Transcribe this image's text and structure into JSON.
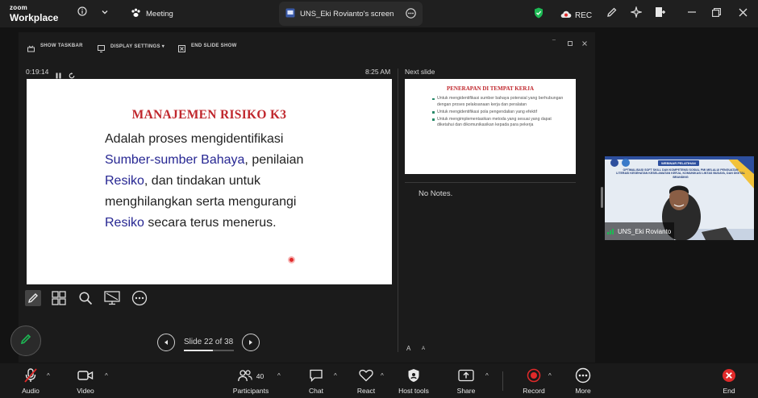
{
  "app": {
    "logo_line1": "zoom",
    "logo_line2": "Workplace"
  },
  "tabs": {
    "meeting": "Meeting",
    "screen": "UNS_Eki Rovianto's screen"
  },
  "status": {
    "rec": "REC"
  },
  "presenter_toolbar": {
    "show_taskbar": "SHOW TASKBAR",
    "display_settings": "DISPLAY SETTINGS ▾",
    "end_slide_show": "END SLIDE SHOW"
  },
  "presenter": {
    "timer": "0:19:14",
    "clock": "8:25 AM",
    "next_slide_label": "Next slide",
    "notes": "No Notes.",
    "slide_counter": "Slide 22 of 38",
    "slide_progress": 0.58,
    "font_up": "A",
    "font_down": "A"
  },
  "slide": {
    "title": "MANAJEMEN RISIKO K3",
    "p1": "Adalah proses mengidentifikasi",
    "p2a": "Sumber-sumber Bahaya",
    "p2b": ", penilaian",
    "p3a": "Resiko",
    "p3b": ", dan tindakan untuk",
    "p4": "menghilangkan serta mengurangi",
    "p5a": "Resiko",
    "p5b": " secara terus menerus."
  },
  "next_slide": {
    "title": "PENERAPAN DI TEMPAT KERJA",
    "bullets": [
      "Untuk mengidentifikasi sumber bahaya potensial yang berhubungan dengan proses pelaksanaan kerja dan peralatan",
      "Untuk mengidentifikasi pola pengendalian yang efektif",
      "Untuk mengimplementasikan metoda yang sesuai yang dapat diketahui dan dikomunikasikan kepada para pekerja"
    ]
  },
  "video": {
    "name": "UNS_Eki Rovianto",
    "banner_badge": "WEBINAR PELATIHAN",
    "banner_text": "OPTIMALISASI SOFT SKILL DAN KOMPETENSI SOSIAL PMI MELALUI PENGUATAN LITERASI KESEHATAN KESELAMATAN KERJA, KOMUNIKASI LINTAS BUDAYA, DAN DIGITAL BRANDING"
  },
  "bottom_bar": {
    "audio": "Audio",
    "video": "Video",
    "participants": "Participants",
    "participants_count": "40",
    "chat": "Chat",
    "react": "React",
    "host_tools": "Host tools",
    "share": "Share",
    "record": "Record",
    "more": "More",
    "end": "End"
  },
  "colors": {
    "accent_red": "#e02a2a",
    "shield_green": "#1db954",
    "slide_title_red": "#c0272d",
    "slide_highlight": "#262692"
  }
}
